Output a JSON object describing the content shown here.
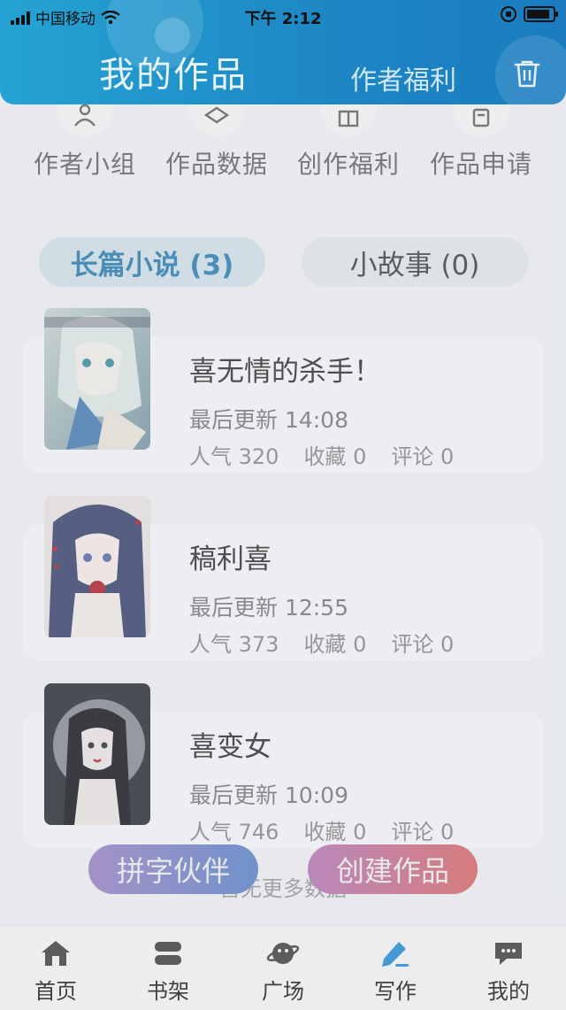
{
  "status_bar": {
    "carrier": "中国移动",
    "time": "下午 2:12"
  },
  "header": {
    "title": "我的作品",
    "welfare_link": "作者福利",
    "trash_icon": "trash-icon"
  },
  "quick_actions": [
    {
      "label": "作者小组",
      "icon": "group-icon"
    },
    {
      "label": "作品数据",
      "icon": "data-icon"
    },
    {
      "label": "创作福利",
      "icon": "gift-icon"
    },
    {
      "label": "作品申请",
      "icon": "apply-icon"
    }
  ],
  "tabs": [
    {
      "label": "长篇小说 (3)",
      "active": true
    },
    {
      "label": "小故事 (0)",
      "active": false
    }
  ],
  "works": [
    {
      "title": "喜无情的杀手！",
      "updated": "最后更新 14:08",
      "popularity": "人气 320",
      "favorites": "收藏 0",
      "comments": "评论 0"
    },
    {
      "title": "稿利喜",
      "updated": "最后更新 12:55",
      "popularity": "人气 373",
      "favorites": "收藏 0",
      "comments": "评论 0"
    },
    {
      "title": "喜变女",
      "updated": "最后更新 10:09",
      "popularity": "人气 746",
      "favorites": "收藏 0",
      "comments": "评论 0"
    }
  ],
  "no_more_text": "暂无更多数据",
  "fabs": {
    "partner": "拼字伙伴",
    "create": "创建作品"
  },
  "bottom_nav": [
    {
      "label": "首页",
      "icon": "home-icon"
    },
    {
      "label": "书架",
      "icon": "bookshelf-icon"
    },
    {
      "label": "广场",
      "icon": "planet-icon"
    },
    {
      "label": "写作",
      "icon": "pen-icon",
      "active": true
    },
    {
      "label": "我的",
      "icon": "chat-icon"
    }
  ],
  "colors": {
    "header": "#1d86c4",
    "accent": "#2f7fb0",
    "active_nav": "#2a8fd3"
  }
}
